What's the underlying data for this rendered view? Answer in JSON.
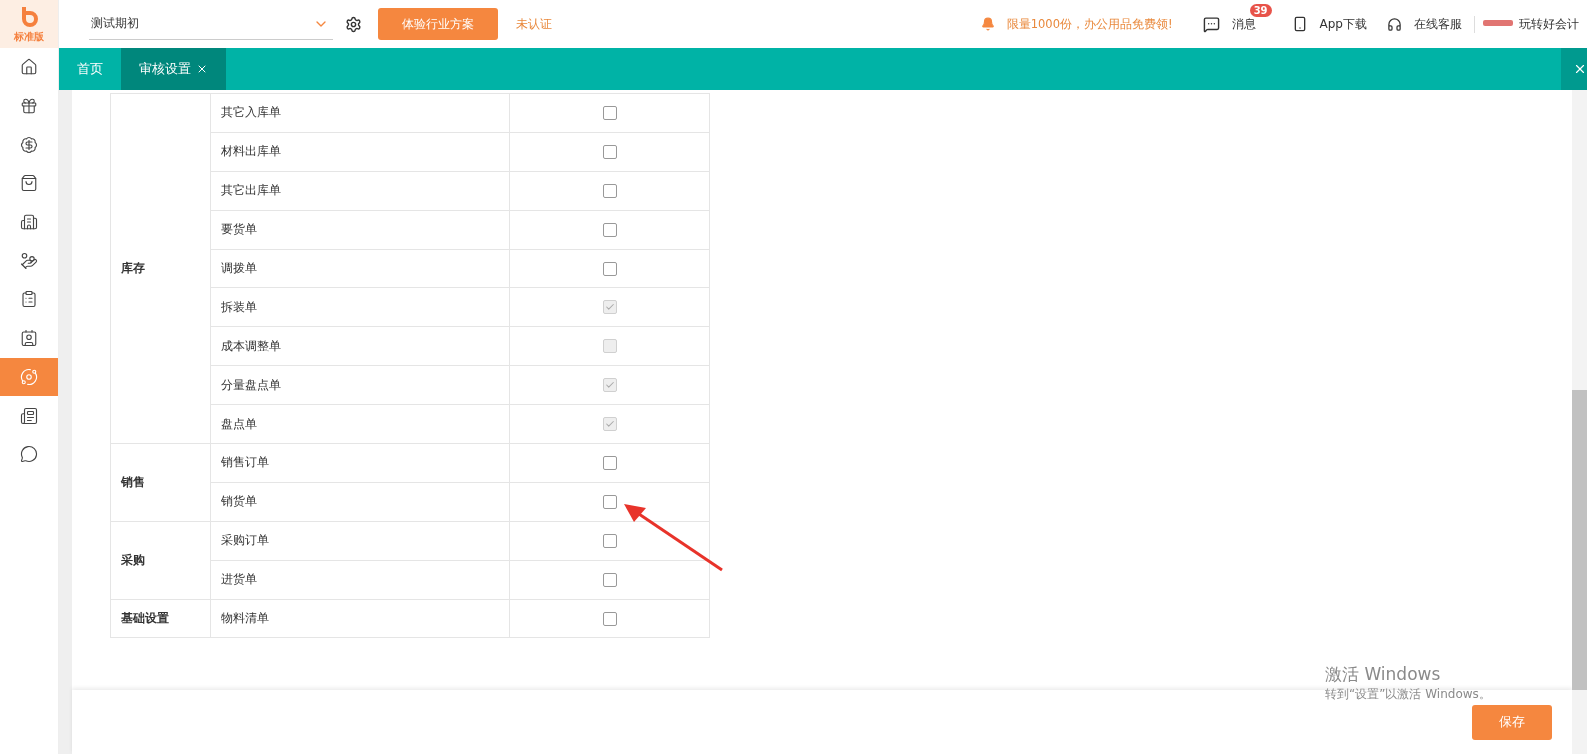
{
  "logo": {
    "text": "标准版"
  },
  "sidebar": {
    "items": [
      {
        "selected": false
      },
      {
        "selected": false
      },
      {
        "selected": false
      },
      {
        "selected": false
      },
      {
        "selected": false
      },
      {
        "selected": false
      },
      {
        "selected": false
      },
      {
        "selected": false
      },
      {
        "selected": true
      },
      {
        "selected": false
      },
      {
        "selected": false
      }
    ]
  },
  "topbar": {
    "account_select": {
      "value": "测试期初"
    },
    "trial_button": "体验行业方案",
    "status": "未认证",
    "promo": "限量1000份，办公用品免费领!",
    "messages": {
      "label": "消息",
      "badge": "39"
    },
    "app_download": "App下载",
    "support": "在线客服",
    "user": "玩转好会计"
  },
  "tabs": [
    {
      "label": "首页",
      "selected": false,
      "closable": false
    },
    {
      "label": "审核设置",
      "selected": true,
      "closable": true
    }
  ],
  "table": {
    "groups": [
      {
        "name": "库存",
        "rows": [
          {
            "name": "其它入库单",
            "checked": false,
            "disabled": false
          },
          {
            "name": "材料出库单",
            "checked": false,
            "disabled": false
          },
          {
            "name": "其它出库单",
            "checked": false,
            "disabled": false
          },
          {
            "name": "要货单",
            "checked": false,
            "disabled": false
          },
          {
            "name": "调拨单",
            "checked": false,
            "disabled": false
          },
          {
            "name": "拆装单",
            "checked": true,
            "disabled": true
          },
          {
            "name": "成本调整单",
            "checked": false,
            "disabled": true
          },
          {
            "name": "分量盘点单",
            "checked": true,
            "disabled": true
          },
          {
            "name": "盘点单",
            "checked": true,
            "disabled": true
          }
        ]
      },
      {
        "name": "销售",
        "rows": [
          {
            "name": "销售订单",
            "checked": false,
            "disabled": false
          },
          {
            "name": "销货单",
            "checked": false,
            "disabled": false
          }
        ]
      },
      {
        "name": "采购",
        "rows": [
          {
            "name": "采购订单",
            "checked": false,
            "disabled": false
          },
          {
            "name": "进货单",
            "checked": false,
            "disabled": false
          }
        ]
      },
      {
        "name": "基础设置",
        "rows": [
          {
            "name": "物料清单",
            "checked": false,
            "disabled": false
          }
        ]
      }
    ]
  },
  "save_button": "保存",
  "windows_notice": {
    "title": "激活 Windows",
    "subtitle": "转到“设置”以激活 Windows。"
  }
}
